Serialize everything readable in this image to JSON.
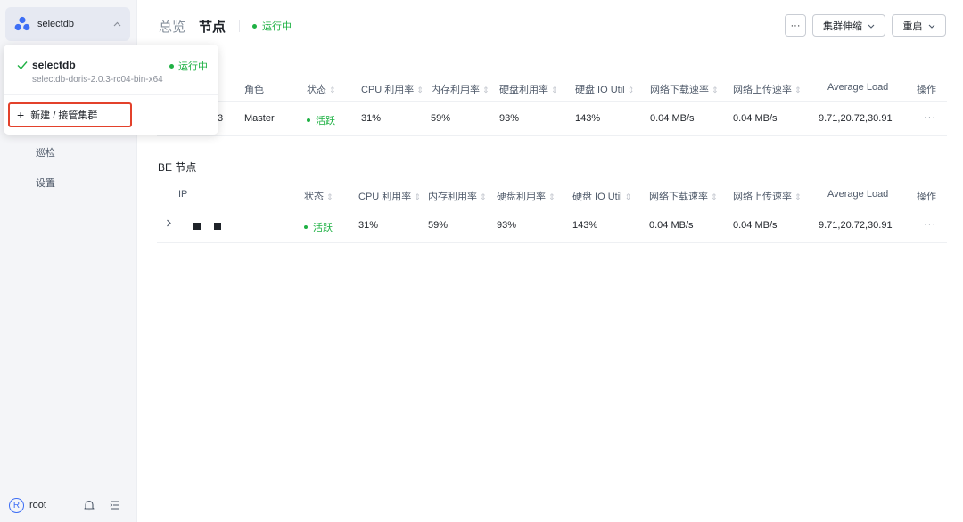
{
  "sidebar": {
    "cluster_name": "selectdb",
    "nav": [
      "巡检",
      "设置"
    ],
    "user": {
      "initial": "R",
      "name": "root"
    }
  },
  "dropdown": {
    "cluster_name": "selectdb",
    "cluster_status": "运行中",
    "cluster_version": "selectdb-doris-2.0.3-rc04-bin-x64",
    "new_label": "新建 / 接管集群"
  },
  "header": {
    "tab_overview": "总览",
    "tab_nodes": "节点",
    "status": "运行中",
    "more_label": "···",
    "scale_label": "集群伸缩",
    "restart_label": "重启"
  },
  "fe_table": {
    "headers": [
      "角色",
      "状态",
      "CPU 利用率",
      "内存利用率",
      "硬盘利用率",
      "硬盘 IO Util",
      "网络下载速率",
      "网络上传速率",
      "Average Load",
      "操作"
    ],
    "row": {
      "ip_tail": "3",
      "role": "Master",
      "status": "活跃",
      "cpu": "31%",
      "mem": "59%",
      "disk": "93%",
      "io": "143%",
      "down": "0.04 MB/s",
      "up": "0.04 MB/s",
      "load": "9.71,20.72,30.91",
      "op": "···"
    }
  },
  "be_table": {
    "title": "BE 节点",
    "headers": [
      "IP",
      "状态",
      "CPU 利用率",
      "内存利用率",
      "硬盘利用率",
      "硬盘 IO Util",
      "网络下载速率",
      "网络上传速率",
      "Average Load",
      "操作"
    ],
    "row": {
      "status": "活跃",
      "cpu": "31%",
      "mem": "59%",
      "disk": "93%",
      "io": "143%",
      "down": "0.04 MB/s",
      "up": "0.04 MB/s",
      "load": "9.71,20.72,30.91",
      "op": "···"
    }
  },
  "colors": {
    "accent": "#3d6ef5",
    "success": "#1fb144",
    "highlight": "#e3412b"
  }
}
